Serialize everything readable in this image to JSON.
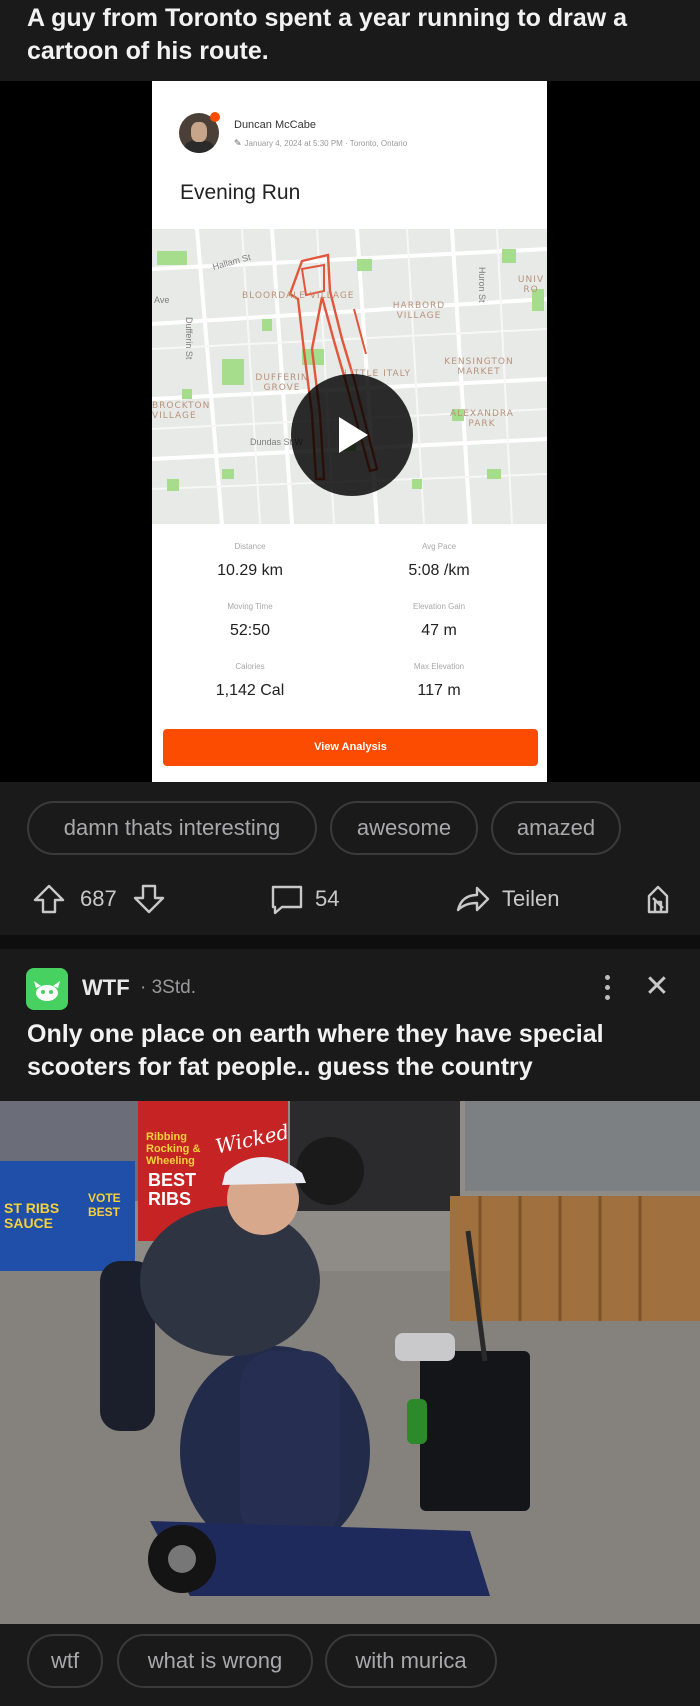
{
  "post1": {
    "title": "A guy from Toronto spent a year running to draw a cartoon of his route.",
    "activity": {
      "athlete": "Duncan McCabe",
      "meta": "January 4, 2024 at 5:30 PM · Toronto, Ontario",
      "title": "Evening Run",
      "map_labels": {
        "bloordale": "BLOORDALE VILLAGE",
        "harbord": "HARBORD VILLAGE",
        "little_italy": "LITTLE ITALY",
        "kensington": "KENSINGTON MARKET",
        "alexandra": "ALEXANDRA PARK",
        "dufferin_grove": "DUFFERIN GROVE",
        "brockton": "BROCKTON VILLAGE",
        "univ": "UNIV RO",
        "dundas": "Dundas St W",
        "dufferin_st": "Dufferin St",
        "hallam": "Hallam St",
        "huron": "Huron St",
        "ave": "Ave"
      },
      "stats": [
        {
          "label": "Distance",
          "value": "10.29 km"
        },
        {
          "label": "Avg Pace",
          "value": "5:08 /km"
        },
        {
          "label": "Moving Time",
          "value": "52:50"
        },
        {
          "label": "Elevation Gain",
          "value": "47 m"
        },
        {
          "label": "Calories",
          "value": "1,142 Cal"
        },
        {
          "label": "Max Elevation",
          "value": "117 m"
        }
      ],
      "button": "View Analysis"
    },
    "chips": [
      "damn thats interesting",
      "awesome",
      "amazed"
    ],
    "votes": "687",
    "comments": "54",
    "share": "Teilen"
  },
  "post2": {
    "subreddit": "WTF",
    "time": "· 3Std.",
    "title": "Only one place on earth where they have special scooters for fat people.. guess the country",
    "photo_signs": {
      "sign1": "Ribbing Rocking & Wheeling",
      "sign2": "BEST RIBS",
      "sign3": "Wicked",
      "sign4": "ST RIBS SAUCE",
      "sign5": "VOTE BEST"
    },
    "chips": [
      "wtf",
      "what is wrong",
      "with murica"
    ]
  },
  "colors": {
    "background": "#1a1a1b",
    "strava_orange": "#fc4c02",
    "route": "#e2573b",
    "subreddit_icon": "#46d160"
  }
}
